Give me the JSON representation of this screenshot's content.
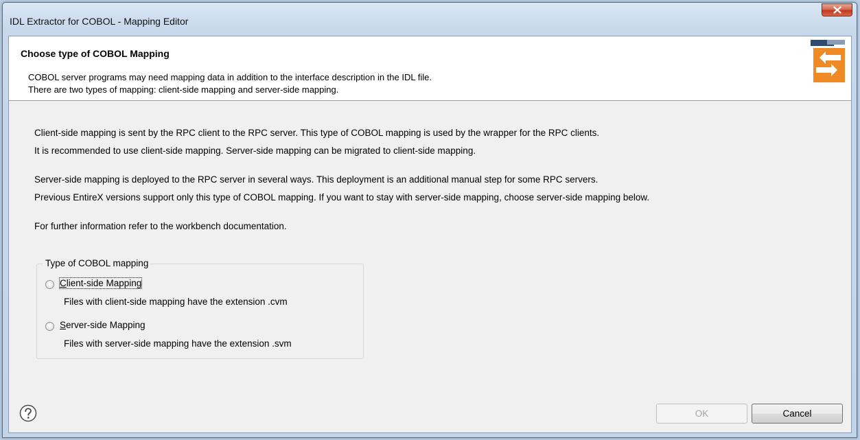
{
  "window": {
    "title": "IDL Extractor for COBOL - Mapping Editor",
    "close_icon": "close-x-icon"
  },
  "banner": {
    "title": "Choose type of COBOL Mapping",
    "line1": "COBOL server programs may need mapping data in addition to  the interface description in the IDL file.",
    "line2": "There are two types of mapping: client-side mapping and server-side mapping.",
    "icon": "mapping-arrows-icon"
  },
  "body": {
    "p1_line1": "Client-side mapping is sent by the RPC client to the RPC server. This type of COBOL mapping is used by the wrapper for the RPC clients.",
    "p1_line2": "It is recommended to use client-side mapping. Server-side mapping can be migrated to client-side mapping.",
    "p2_line1": "Server-side mapping is deployed to the RPC server in several ways. This deployment is an additional manual step for some RPC servers.",
    "p2_line2": "Previous EntireX versions support only this type of COBOL mapping. If you want to stay with server-side mapping, choose server-side mapping below.",
    "p3": "For further information refer to the workbench documentation."
  },
  "mapping_group": {
    "legend": "Type of COBOL mapping",
    "options": [
      {
        "label": "Client-side Mapping",
        "mnemonic": "C",
        "label_rest": "lient-side Mapping",
        "description": "Files with client-side mapping have the extension .cvm",
        "selected": false,
        "focused": true
      },
      {
        "label": "Server-side Mapping",
        "mnemonic": "S",
        "label_rest": "erver-side Mapping",
        "description": "Files with server-side mapping have the extension .svm",
        "selected": false,
        "focused": false
      }
    ]
  },
  "footer": {
    "help_icon": "help-question-icon",
    "ok_label": "OK",
    "ok_enabled": false,
    "cancel_label": "Cancel"
  },
  "colors": {
    "accent_orange": "#f08a24",
    "banner_bg": "#ffffff",
    "dialog_bg": "#f0f0f0"
  }
}
